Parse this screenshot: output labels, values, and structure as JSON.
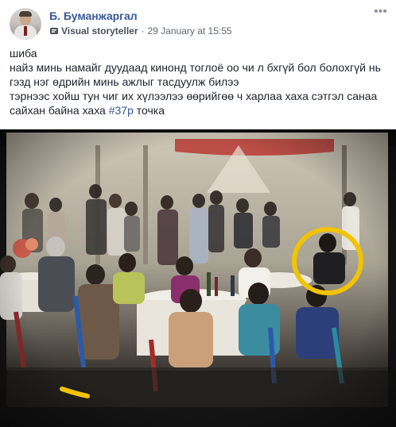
{
  "post": {
    "author": "Б. Буманжаргал",
    "badge": "Visual storyteller",
    "date": "29 January at 15:55",
    "text_lines": [
      "шиба",
      "найз минь намайг дуудаад кинонд тоглоё оо чи л бхгүй бол болохгүй нь",
      "гэзд нэг өдрийн минь ажлыг тасдуулж билээ",
      "тэрнээс хойш тун чиг их хүлээлээ өөрийгөө ч харлаа хаха сэтгэл санаа"
    ],
    "last_line_before": "сайхан байна хаха ",
    "hashtag": "#37р",
    "last_line_after": " точка"
  },
  "icons": {
    "avatar": "profile-photo",
    "badge": "visual-storyteller-icon",
    "more": "more-options-icon"
  },
  "photo": {
    "subject": "film-still-on-screen",
    "highlight_color": "#f2c300"
  }
}
